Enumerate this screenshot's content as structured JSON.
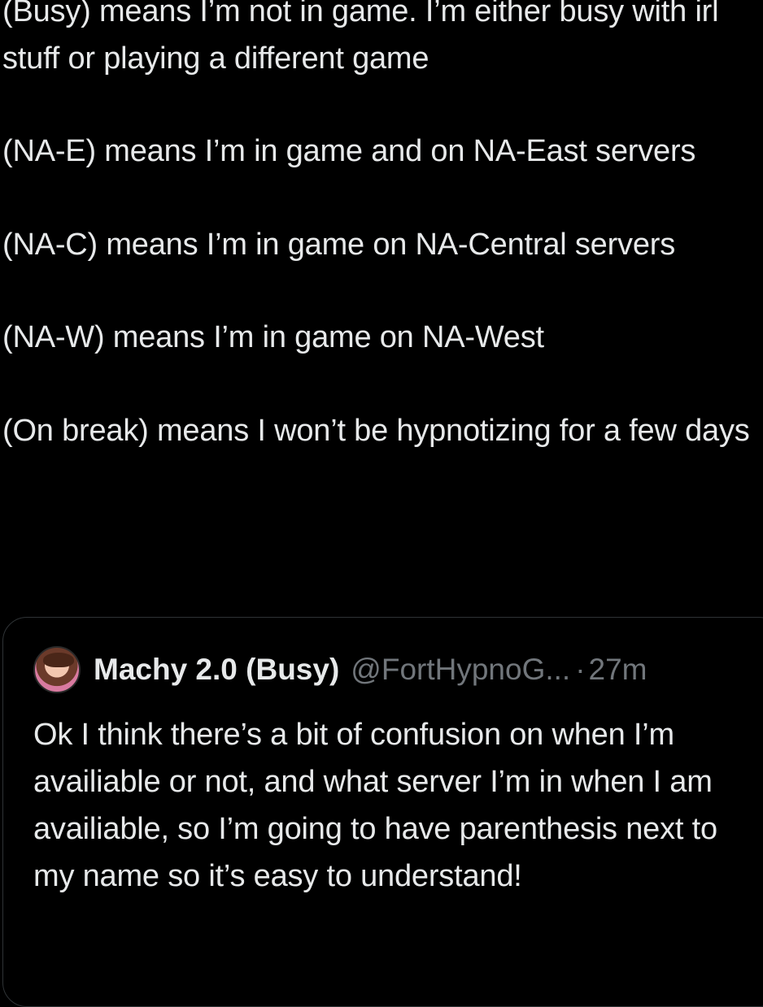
{
  "tweet": {
    "paragraphs": [
      "(Busy) means I’m not in game. I’m either busy with irl stuff or playing a different game",
      "(NA-E) means I’m in game and on NA-East servers",
      "(NA-C) means I’m in game on NA-Central servers",
      "(NA-W) means I’m in game on NA-West",
      "(On break) means I won’t be hypnotizing for a few days"
    ]
  },
  "quote": {
    "avatar": "avatar-image",
    "display_name": "Machy 2.0 (Busy)",
    "handle": "@FortHypnoG...",
    "separator": "·",
    "time": "27m",
    "text": "Ok I think there’s a bit of confusion on when I’m availiable or not, and what server I’m in when I am availiable, so I’m going to have parenthesis next to my name so it’s easy to understand!"
  },
  "colors": {
    "background": "#000000",
    "text": "#e7e9ea",
    "secondary_text": "#71767b",
    "border": "#2f3336"
  }
}
